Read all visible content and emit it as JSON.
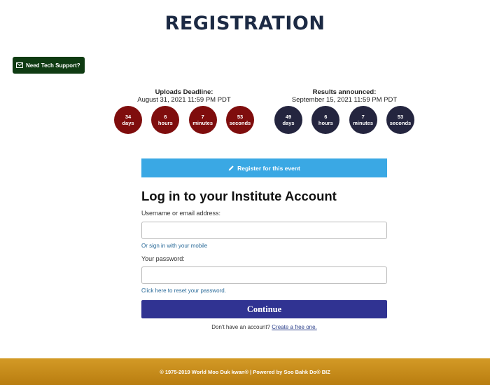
{
  "page": {
    "title": "REGISTRATION"
  },
  "support": {
    "label": "Need Tech Support?"
  },
  "uploads": {
    "label": "Uploads Deadline:",
    "date": "August 31, 2021 11:59 PM PDT",
    "units": [
      {
        "value": "34",
        "unit": "days"
      },
      {
        "value": "6",
        "unit": "hours"
      },
      {
        "value": "7",
        "unit": "minutes"
      },
      {
        "value": "53",
        "unit": "seconds"
      }
    ]
  },
  "results": {
    "label": "Results announced:",
    "date": "September 15, 2021 11:59 PM PDT",
    "units": [
      {
        "value": "49",
        "unit": "days"
      },
      {
        "value": "6",
        "unit": "hours"
      },
      {
        "value": "7",
        "unit": "minutes"
      },
      {
        "value": "53",
        "unit": "seconds"
      }
    ]
  },
  "register": {
    "label": "Register for this event"
  },
  "login": {
    "heading": "Log in to your Institute Account",
    "username_label": "Username or email address:",
    "username_value": "",
    "mobile_link": "Or sign in with your mobile",
    "password_label": "Your password:",
    "password_value": "",
    "reset_link": "Click here to reset your password.",
    "continue_label": "Continue",
    "no_account_text": "Don't have an account?",
    "create_link": "Create a free one."
  },
  "footer": {
    "text": "© 1975-2019 World Moo Duk kwan® | Powered by Soo Bahk Do® BIZ"
  },
  "colors": {
    "uploads_circle": "#7f0d0d",
    "results_circle": "#24253f",
    "register_button": "#3aa8e4",
    "continue_button": "#303392",
    "support_button": "#0f3b12",
    "footer": "#c98c1a"
  }
}
